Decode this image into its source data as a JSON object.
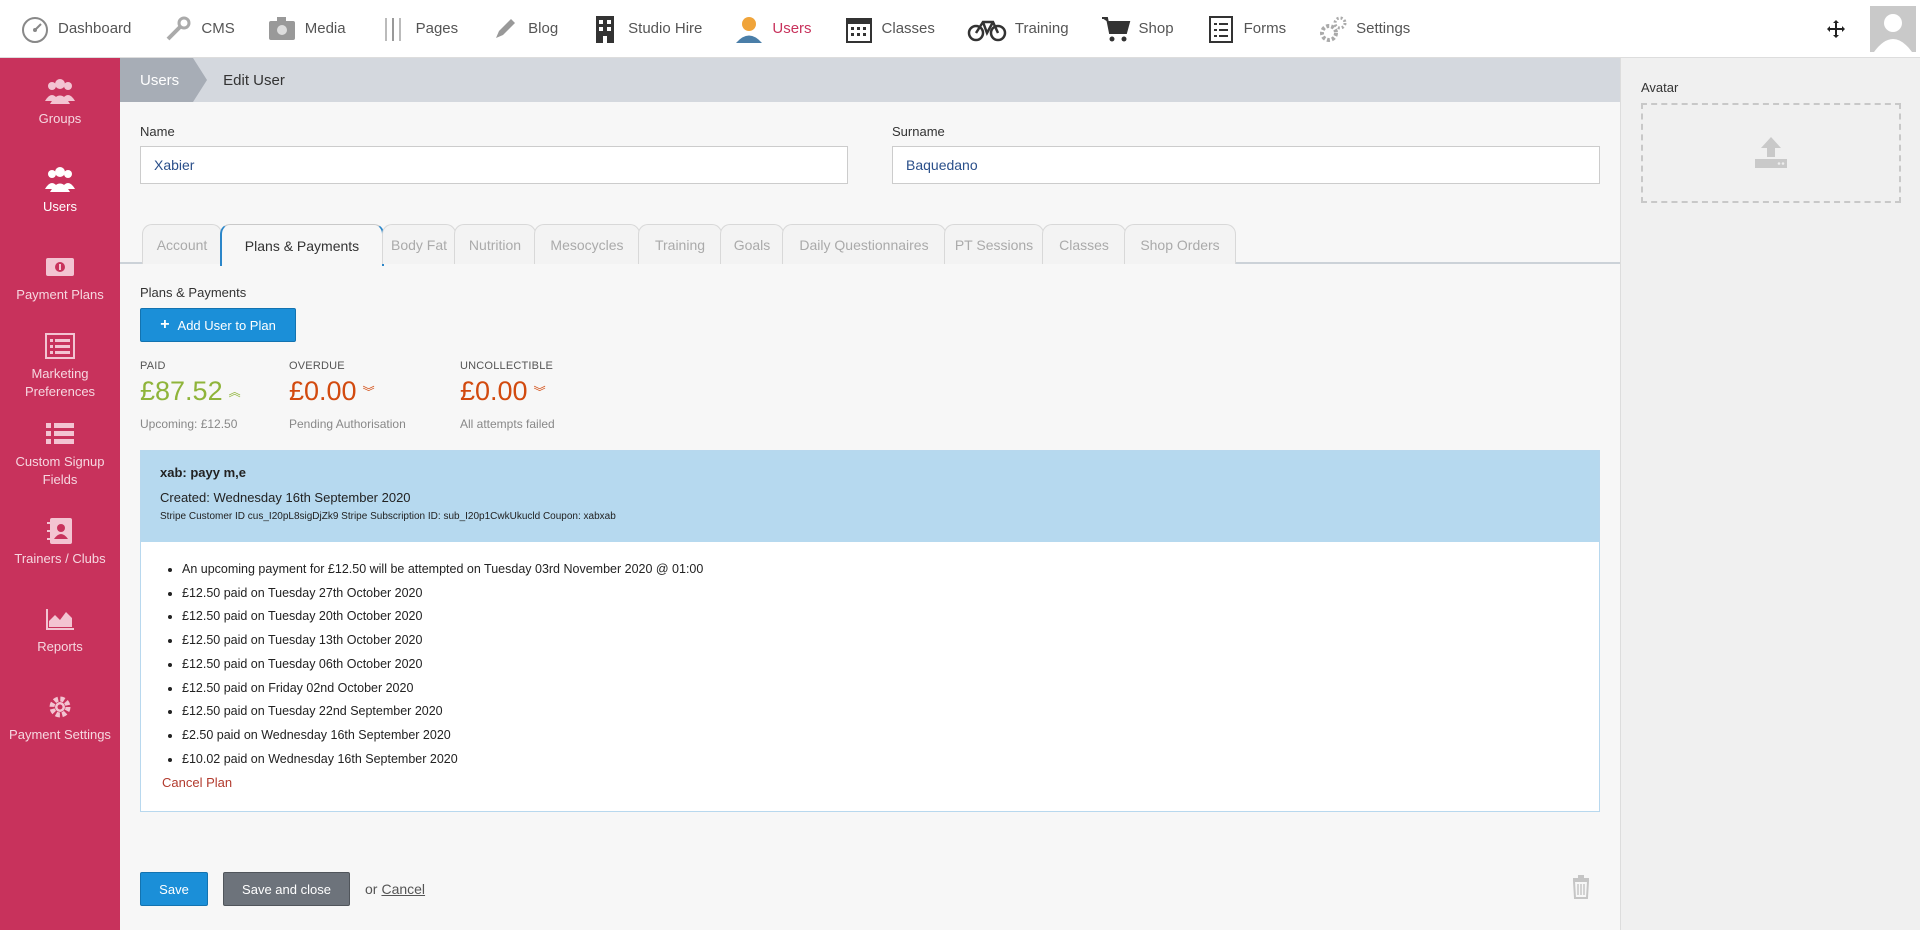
{
  "topnav": {
    "items": [
      {
        "label": "Dashboard",
        "icon": "gauge-icon"
      },
      {
        "label": "CMS",
        "icon": "tools-icon"
      },
      {
        "label": "Media",
        "icon": "camera-icon"
      },
      {
        "label": "Pages",
        "icon": "pages-icon"
      },
      {
        "label": "Blog",
        "icon": "pencil-icon"
      },
      {
        "label": "Studio Hire",
        "icon": "building-icon"
      },
      {
        "label": "Users",
        "icon": "user-icon",
        "active": true
      },
      {
        "label": "Classes",
        "icon": "calendar-icon"
      },
      {
        "label": "Training",
        "icon": "bicycle-icon"
      },
      {
        "label": "Shop",
        "icon": "cart-icon"
      },
      {
        "label": "Forms",
        "icon": "form-icon"
      },
      {
        "label": "Settings",
        "icon": "gears-icon"
      }
    ]
  },
  "sidebar": {
    "items": [
      {
        "label": "Groups",
        "icon": "group-icon"
      },
      {
        "label": "Users",
        "icon": "users-icon",
        "active": true
      },
      {
        "label": "Payment Plans",
        "icon": "money-icon"
      },
      {
        "label": "Marketing Preferences",
        "icon": "list-alt-icon"
      },
      {
        "label": "Custom Signup Fields",
        "icon": "list-icon"
      },
      {
        "label": "Trainers / Clubs",
        "icon": "contact-book-icon"
      },
      {
        "label": "Reports",
        "icon": "area-chart-icon"
      },
      {
        "label": "Payment Settings",
        "icon": "gear-icon"
      }
    ]
  },
  "breadcrumb": {
    "root": "Users",
    "current": "Edit User"
  },
  "form": {
    "name_label": "Name",
    "name_value": "Xabier",
    "surname_label": "Surname",
    "surname_value": "Baquedano"
  },
  "tabs": [
    {
      "label": "Account"
    },
    {
      "label": "Plans & Payments",
      "active": true
    },
    {
      "label": "Body Fat"
    },
    {
      "label": "Nutrition"
    },
    {
      "label": "Mesocycles"
    },
    {
      "label": "Training"
    },
    {
      "label": "Goals"
    },
    {
      "label": "Daily Questionnaires"
    },
    {
      "label": "PT Sessions"
    },
    {
      "label": "Classes"
    },
    {
      "label": "Shop Orders"
    }
  ],
  "plans": {
    "section_title": "Plans & Payments",
    "add_button": "Add User to Plan",
    "stats": {
      "paid": {
        "label": "PAID",
        "amount": "£87.52",
        "sub": "Upcoming: £12.50",
        "color": "#8fb43a"
      },
      "overdue": {
        "label": "OVERDUE",
        "amount": "£0.00",
        "sub": "Pending Authorisation",
        "color": "#d24a0f"
      },
      "uncollectible": {
        "label": "UNCOLLECTIBLE",
        "amount": "£0.00",
        "sub": "All attempts failed",
        "color": "#d24a0f"
      }
    },
    "plan": {
      "name": "xab: payy m,e",
      "created": "Created: Wednesday 16th September 2020",
      "ids": "Stripe Customer ID cus_I20pL8sigDjZk9 Stripe Subscription ID: sub_I20p1CwkUkucld Coupon: xabxab",
      "payments": [
        "An upcoming payment for £12.50 will be attempted on Tuesday 03rd November 2020 @ 01:00",
        "£12.50 paid on Tuesday 27th October 2020",
        "£12.50 paid on Tuesday 20th October 2020",
        "£12.50 paid on Tuesday 13th October 2020",
        "£12.50 paid on Tuesday 06th October 2020",
        "£12.50 paid on Friday 02nd October 2020",
        "£12.50 paid on Tuesday 22nd September 2020",
        "£2.50 paid on Wednesday 16th September 2020",
        "£10.02 paid on Wednesday 16th September 2020"
      ],
      "cancel_label": "Cancel Plan"
    }
  },
  "footer": {
    "save": "Save",
    "save_close": "Save and close",
    "or": "or",
    "cancel": "Cancel"
  },
  "avatar_panel": {
    "label": "Avatar"
  },
  "colors": {
    "brand": "#c8325c",
    "primary": "#1b8fd8",
    "plan_header": "#b6d9ef"
  }
}
